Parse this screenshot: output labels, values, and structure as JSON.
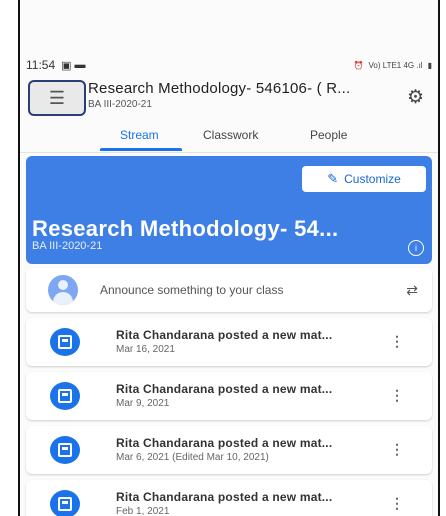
{
  "status_bar": {
    "time": "11:54",
    "right_icons": "Vo) LTE1 4G .ıl"
  },
  "header": {
    "title": "Research Methodology- 546106- ( R...",
    "subtitle": "BA III-2020-21",
    "menu_icon": "menu-icon",
    "settings_icon": "gear-icon"
  },
  "tabs": [
    {
      "label": "Stream"
    },
    {
      "label": "Classwork"
    },
    {
      "label": "People"
    }
  ],
  "banner": {
    "customize_label": "Customize",
    "title": "Research Methodology- 54...",
    "subtitle": "BA III-2020-21",
    "color": "#3e7fe5"
  },
  "announce": {
    "placeholder": "Announce something to your class"
  },
  "posts": [
    {
      "title": "Rita Chandarana posted a new mat...",
      "date": "Mar 16, 2021"
    },
    {
      "title": "Rita Chandarana posted a new mat...",
      "date": "Mar 9, 2021"
    },
    {
      "title": "Rita Chandarana posted a new mat...",
      "date": "Mar 6, 2021 (Edited Mar 10, 2021)"
    },
    {
      "title": "Rita Chandarana posted a new mat...",
      "date": "Feb 1, 2021"
    }
  ],
  "accent": "#1a73e8"
}
